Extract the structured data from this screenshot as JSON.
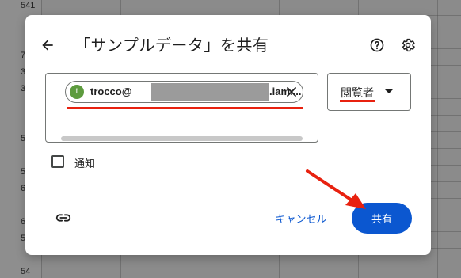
{
  "background": {
    "row_numbers": [
      "541",
      "7",
      "3",
      "3",
      "5",
      "5",
      "6",
      "6",
      "5",
      "54"
    ]
  },
  "dialog": {
    "title": "「サンプルデータ」を共有",
    "back_icon": "arrow-back-icon",
    "help_icon": "help-circle-icon",
    "settings_icon": "gear-icon"
  },
  "recipient_chip": {
    "avatar_letter": "t",
    "email_prefix": "trocco@",
    "email_suffix": ".iam....",
    "avatar_color": "#5d9b3e"
  },
  "role": {
    "selected": "閲覧者"
  },
  "notify": {
    "label": "通知",
    "checked": false
  },
  "footer": {
    "link_icon": "link-icon",
    "cancel_label": "キャンセル",
    "share_label": "共有"
  },
  "colors": {
    "primary": "#0b57d0",
    "annotation_red": "#e8210f"
  }
}
